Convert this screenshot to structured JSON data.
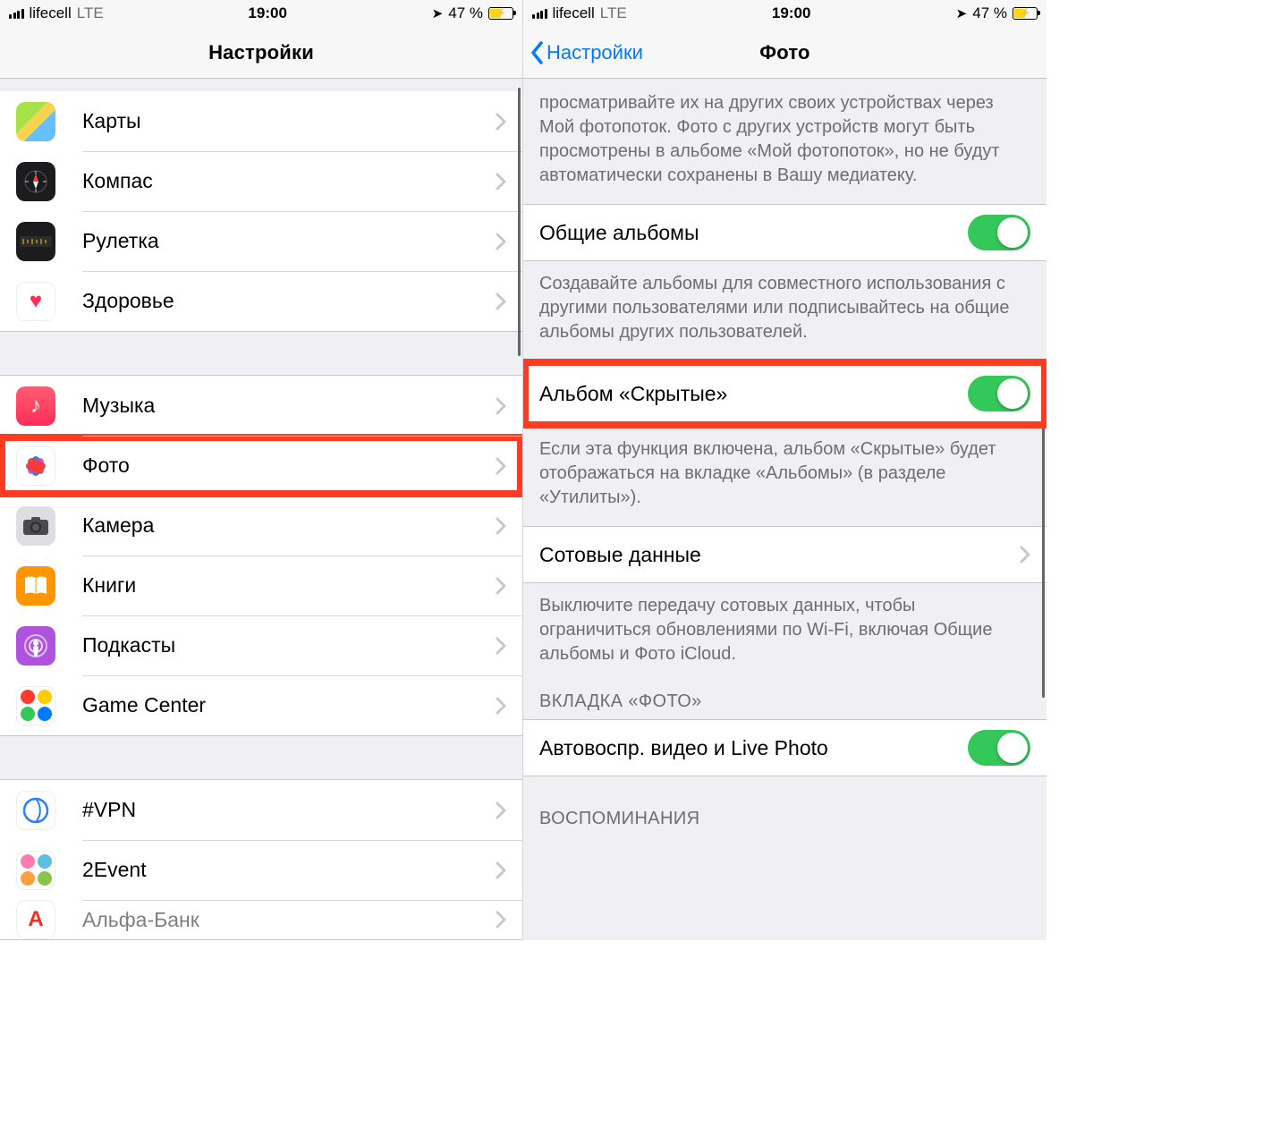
{
  "status": {
    "carrier": "lifecell",
    "net": "LTE",
    "time": "19:00",
    "battery_pct": "47 %"
  },
  "left": {
    "title": "Настройки",
    "g1": [
      {
        "k": "maps",
        "label": "Карты"
      },
      {
        "k": "compass",
        "label": "Компас"
      },
      {
        "k": "ruler",
        "label": "Рулетка"
      },
      {
        "k": "health",
        "label": "Здоровье"
      }
    ],
    "g2": [
      {
        "k": "music",
        "label": "Музыка"
      },
      {
        "k": "photos",
        "label": "Фото",
        "hl": true
      },
      {
        "k": "camera",
        "label": "Камера"
      },
      {
        "k": "books",
        "label": "Книги"
      },
      {
        "k": "podcasts",
        "label": "Подкасты"
      },
      {
        "k": "gc",
        "label": "Game Center"
      }
    ],
    "g3": [
      {
        "k": "vpn",
        "label": "#VPN"
      },
      {
        "k": "2event",
        "label": "2Event"
      },
      {
        "k": "alpha",
        "label": "Альфа-Банк"
      }
    ]
  },
  "right": {
    "back": "Настройки",
    "title": "Фото",
    "desc_top": "просматривайте их на других своих устройствах через Мой фотопоток. Фото с других устройств могут быть просмотрены в альбоме «Мой фотопоток», но не будут автоматически сохранены в Вашу медиатеку.",
    "shared": {
      "label": "Общие альбомы",
      "on": true
    },
    "shared_desc": "Создавайте альбомы для совместного использования с другими пользователями или подписывайтесь на общие альбомы других пользователей.",
    "hidden": {
      "label": "Альбом «Скрытые»",
      "on": true
    },
    "hidden_desc": "Если эта функция включена, альбом «Скрытые» будет отображаться на вкладке «Альбомы» (в разделе «Утилиты»).",
    "cell": {
      "label": "Сотовые данные"
    },
    "cell_desc": "Выключите передачу сотовых данных, чтобы ограничиться обновлениями по Wi-Fi, включая Общие альбомы и Фото iCloud.",
    "sec_photos": "ВКЛАДКА «ФОТО»",
    "autoplay": {
      "label": "Автовоспр. видео и Live Photo",
      "on": true
    },
    "sec_mem": "ВОСПОМИНАНИЯ"
  }
}
